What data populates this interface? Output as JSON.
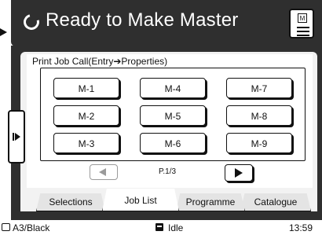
{
  "header": {
    "title": "Ready to Make Master"
  },
  "panel": {
    "title": "Print Job Call(Entry➔Properties)",
    "jobs": [
      "M-1",
      "M-4",
      "M-7",
      "M-2",
      "M-5",
      "M-8",
      "M-3",
      "M-6",
      "M-9"
    ],
    "page": "P.1/3"
  },
  "tabs": [
    "Selections",
    "Job List",
    "Programme",
    "Catalogue"
  ],
  "active_tab": "Job List",
  "status": {
    "paper": "A3/Black",
    "state": "Idle",
    "time": "13:59"
  },
  "icons": [
    "ready-icon",
    "master-doc-icon",
    "prev-arrow-icon",
    "next-arrow-icon",
    "side-expand-icon",
    "printer-icon",
    "idle-icon"
  ]
}
